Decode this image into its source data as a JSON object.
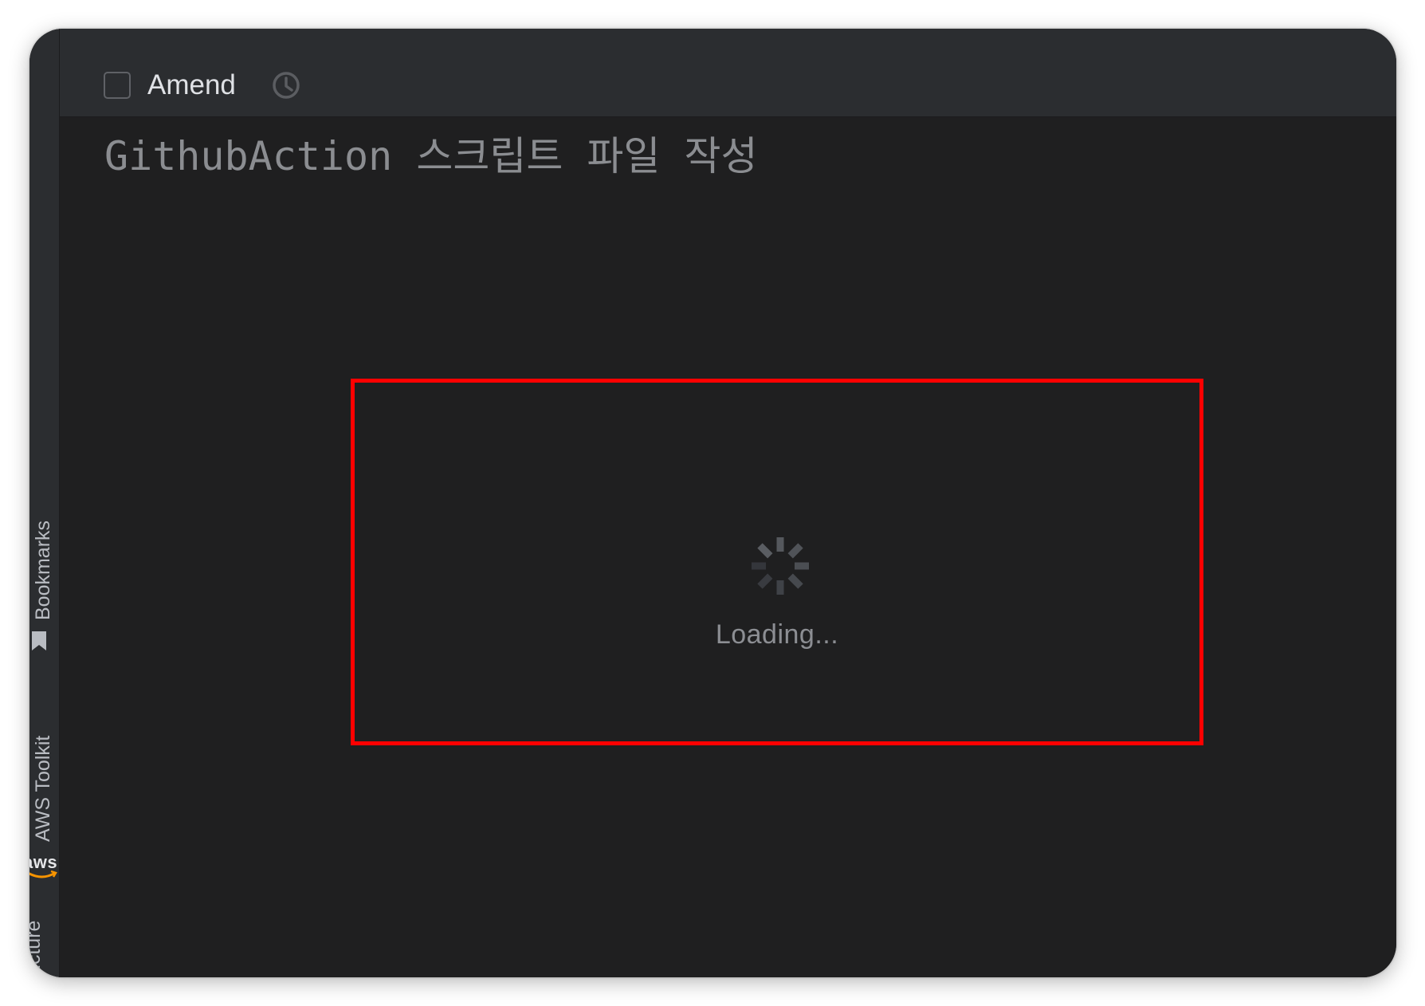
{
  "toolbar": {
    "amend_checked": false,
    "amend_label": "Amend",
    "history_icon": "clock-history-icon"
  },
  "editor": {
    "commit_message": "GithubAction 스크립트 파일 작성"
  },
  "loading": {
    "text": "Loading...",
    "spinner_icon": "spinner-icon",
    "highlight_color": "#ff0000"
  },
  "side_stripe": {
    "tabs": [
      {
        "label": "Bookmarks",
        "icon": "bookmark-icon"
      },
      {
        "label": "AWS Toolkit",
        "icon": "aws-logo-icon"
      },
      {
        "label": "Structure"
      }
    ],
    "aws_logo_text": "aws"
  },
  "colors": {
    "background": "#1f1f20",
    "toolbar": "#2b2d30",
    "accent_highlight": "#ff0000"
  }
}
